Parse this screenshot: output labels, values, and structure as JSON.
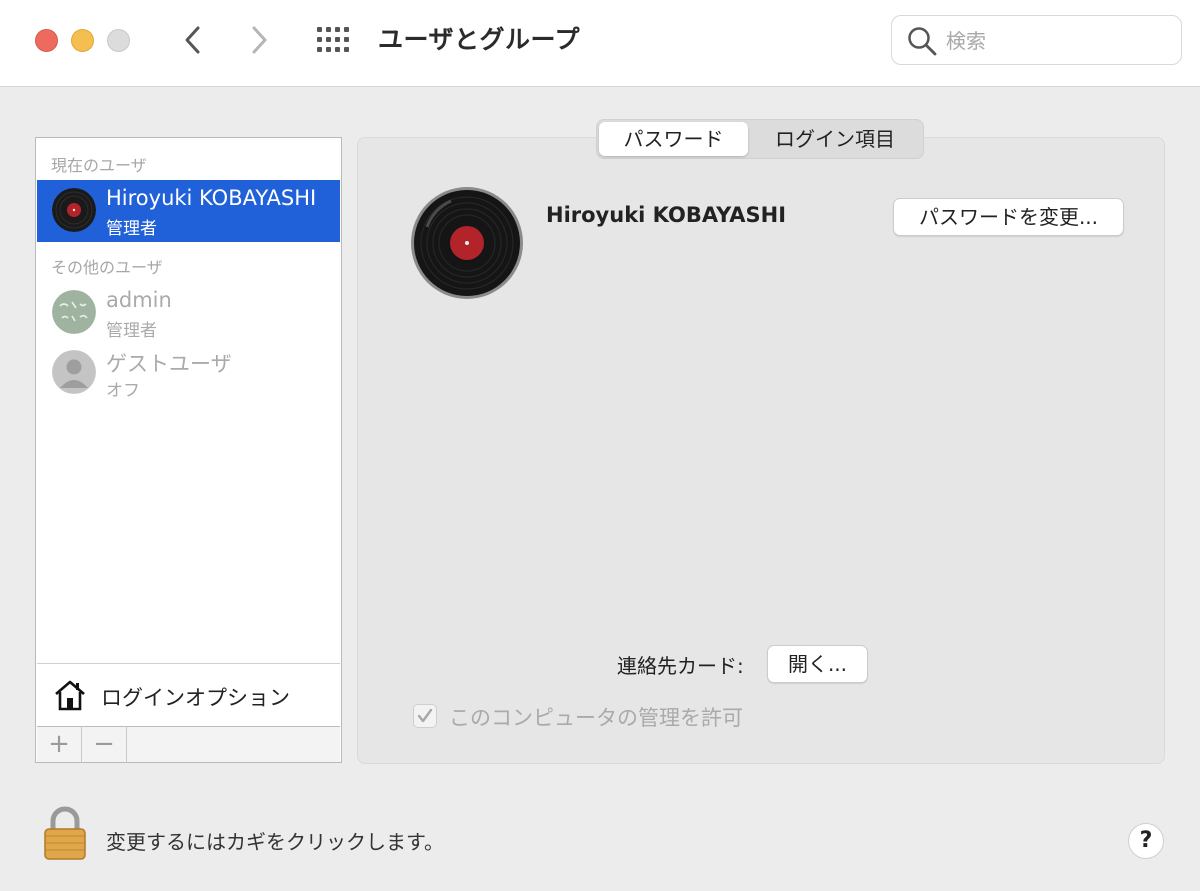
{
  "window": {
    "title": "ユーザとグループ",
    "search_placeholder": "検索"
  },
  "sidebar": {
    "current_user_header": "現在のユーザ",
    "other_users_header": "その他のユーザ",
    "users": [
      {
        "name": "Hiroyuki KOBAYASHI",
        "role": "管理者",
        "selected": true
      },
      {
        "name": "admin",
        "role": "管理者",
        "selected": false
      },
      {
        "name": "ゲストユーザ",
        "role": "オフ",
        "selected": false
      }
    ],
    "login_options_label": "ログインオプション",
    "add_label": "+",
    "remove_label": "−"
  },
  "main": {
    "tabs": [
      {
        "label": "パスワード",
        "selected": true
      },
      {
        "label": "ログイン項目",
        "selected": false
      }
    ],
    "username": "Hiroyuki KOBAYASHI",
    "change_password_label": "パスワードを変更...",
    "contact_card_label": "連絡先カード:",
    "open_label": "開く...",
    "allow_admin_label": "このコンピュータの管理を許可",
    "allow_admin_checked": true
  },
  "footer": {
    "lock_text": "変更するにはカギをクリックします。",
    "help_label": "?"
  },
  "colors": {
    "selection": "#2060d8",
    "close": "#ed6a5e",
    "minimize": "#f5bf4f",
    "zoom": "#dcdcdc"
  },
  "icons": [
    "back-chevron-icon",
    "forward-chevron-icon",
    "grid-icon",
    "search-icon",
    "record-avatar-icon",
    "house-icon",
    "lock-icon",
    "checkmark-icon"
  ]
}
